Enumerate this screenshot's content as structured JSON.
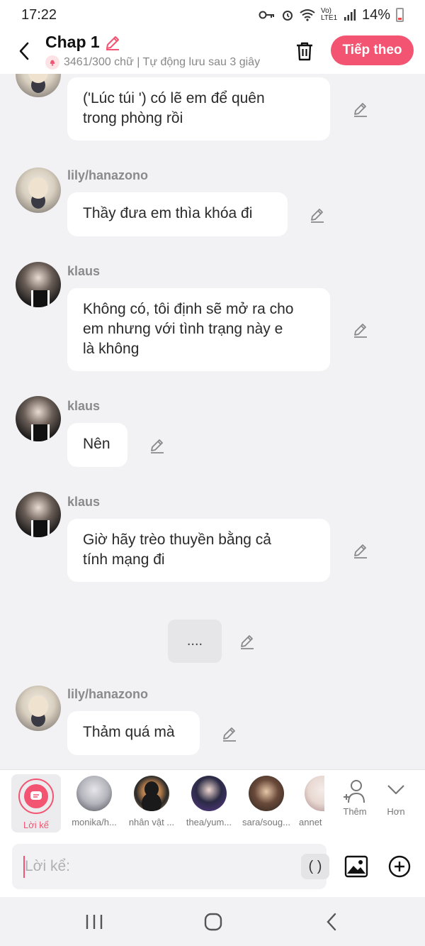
{
  "status": {
    "time": "17:22",
    "network": "Vo) LTE1",
    "battery": "14%"
  },
  "header": {
    "title": "Chap 1",
    "subtitle": "3461/300 chữ | Tự động lưu sau 3 giây",
    "next_label": "Tiếp theo"
  },
  "messages": [
    {
      "speaker": "",
      "avatar": "lily-hanazono-avatar",
      "text_lines": [
        "('Lúc túi ') có lẽ em để quên",
        "trong phòng rồi"
      ]
    },
    {
      "speaker": "lily/hanazono",
      "avatar": "lily-hanazono-avatar",
      "text_lines": [
        "Thầy đưa em thìa khóa đi"
      ]
    },
    {
      "speaker": "klaus",
      "avatar": "klaus-avatar",
      "text_lines": [
        "Không có, tôi định sẽ mở ra cho",
        "em nhưng với tình trạng này e",
        "là không"
      ]
    },
    {
      "speaker": "klaus",
      "avatar": "klaus-avatar",
      "text_lines": [
        "Nên"
      ]
    },
    {
      "speaker": "klaus",
      "avatar": "klaus-avatar",
      "text_lines": [
        "Giờ hãy trèo thuyền bằng cả",
        "tính mạng đi"
      ]
    },
    {
      "speaker": "",
      "avatar": "",
      "text_lines": [
        "...."
      ]
    },
    {
      "speaker": "lily/hanazono",
      "avatar": "lily-hanazono-avatar",
      "text_lines": [
        "Thảm quá mà"
      ]
    }
  ],
  "characters": {
    "narrator_label": "Lời kể",
    "list": [
      {
        "label": "monika/h..."
      },
      {
        "label": "nhân vật ..."
      },
      {
        "label": "thea/yum..."
      },
      {
        "label": "sara/soug..."
      },
      {
        "label": "annet"
      }
    ],
    "add_label": "Thêm",
    "more_label": "Hơn"
  },
  "composer": {
    "placeholder": "Lời kể:",
    "paren_label": "( )"
  },
  "colors": {
    "accent": "#f25471",
    "background": "#f2f2f4",
    "bubble": "#ffffff"
  }
}
